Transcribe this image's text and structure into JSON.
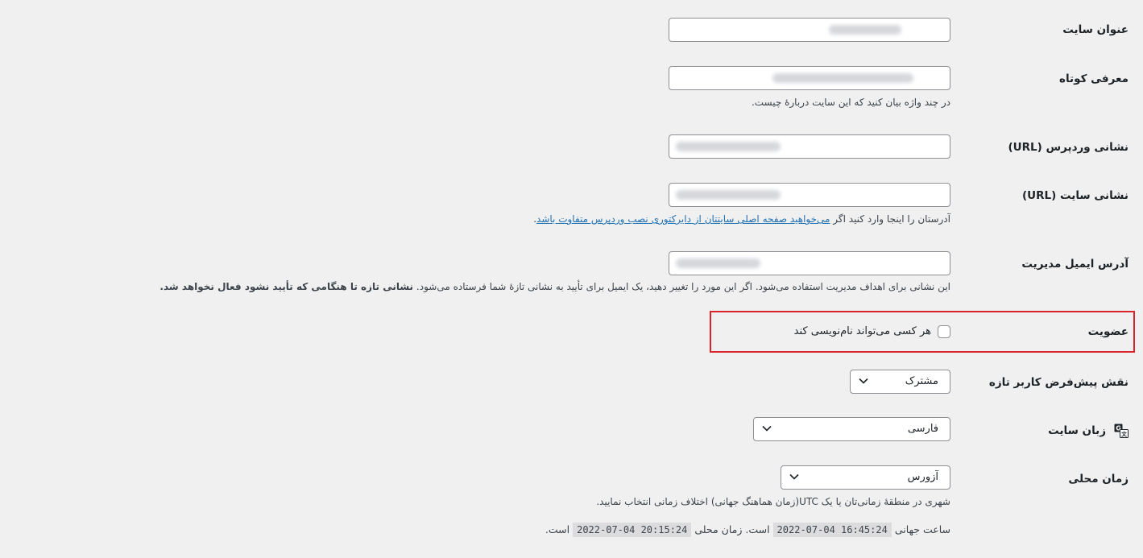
{
  "fields": {
    "site_title": {
      "label": "عنوان سایت",
      "value": ""
    },
    "tagline": {
      "label": "معرفی کوتاه",
      "value": "",
      "description": "در چند واژه بیان کنید که این سایت دربارهٔ چیست."
    },
    "wp_url": {
      "label": "نشانی وردپرس (URL)",
      "value": ""
    },
    "site_url": {
      "label": "نشانی سایت (URL)",
      "value": "",
      "description_prefix": "آدرستان را اینجا وارد کنید اگر ",
      "description_link": "می‌خواهید صفحه اصلی سایتتان از دایرکتوری نصب وردپرس متفاوت باشد",
      "description_suffix": "."
    },
    "admin_email": {
      "label": "آدرس ایمیل مدیریت",
      "value": "",
      "description": "این نشانی برای اهداف مدیریت استفاده می‌شود. اگر این مورد را تغییر دهید، یک ایمیل برای تأیید به نشانی تازهٔ شما فرستاده می‌شود.",
      "description_bold": "نشانی تازه تا هنگامی که تأیید نشود فعال نخواهد شد."
    },
    "membership": {
      "label": "عضویت",
      "checkbox_label": "هر کسی می‌تواند نام‌نویسی کند",
      "checked": false
    },
    "default_role": {
      "label": "نقش پیش‌فرض کاربر تازه",
      "selected": "مشترک"
    },
    "site_language": {
      "label": "زبان سایت",
      "selected": "فارسی"
    },
    "timezone": {
      "label": "زمان محلی",
      "selected": "آزورس",
      "description": "شهری در منطقهٔ زمانی‌تان یا یک UTC(زمان هماهنگ جهانی) اختلاف زمانی انتخاب نمایید.",
      "utc_prefix": "ساعت جهانی",
      "utc_time": "2022-07-04 16:45:24",
      "local_middle": "است. زمان محلی",
      "local_time": "2022-07-04 20:15:24",
      "local_suffix": "است."
    }
  },
  "icons": {
    "language": "translation-icon",
    "dropdown": "chevron-down-icon"
  },
  "colors": {
    "background": "#f0f0f1",
    "link": "#2271b1",
    "highlight_border": "#dc2328"
  }
}
